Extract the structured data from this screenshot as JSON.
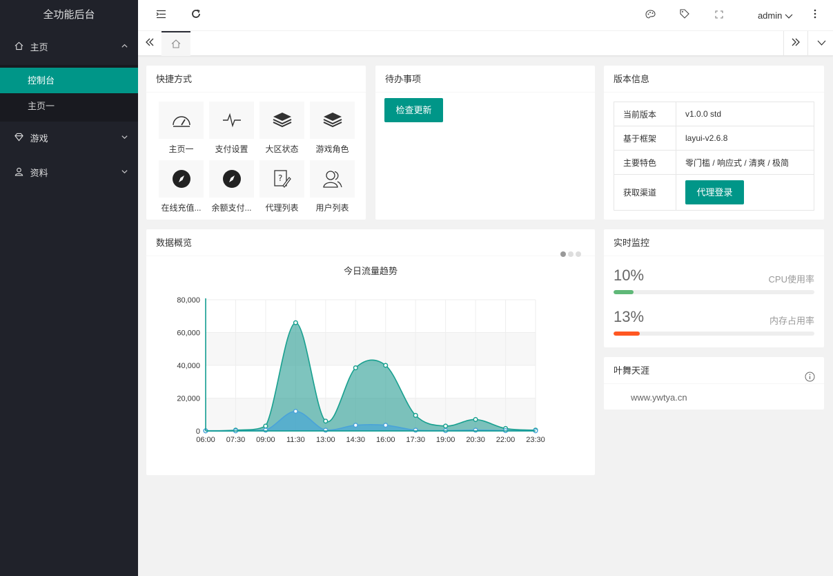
{
  "app": {
    "title": "全功能后台"
  },
  "sidebar": {
    "items": [
      {
        "label": "主页",
        "icon": "home-icon",
        "open": true,
        "children": [
          {
            "label": "控制台",
            "active": true
          },
          {
            "label": "主页一"
          }
        ]
      },
      {
        "label": "游戏",
        "icon": "diamond-icon"
      },
      {
        "label": "资料",
        "icon": "user-icon"
      }
    ]
  },
  "header": {
    "user": "admin"
  },
  "tabs": {
    "home_icon": "home-icon"
  },
  "shortcuts": {
    "title": "快捷方式",
    "items": [
      {
        "label": "主页一",
        "icon": "dashboard-icon"
      },
      {
        "label": "支付设置",
        "icon": "pulse-icon"
      },
      {
        "label": "大区状态",
        "icon": "layers-icon"
      },
      {
        "label": "游戏角色",
        "icon": "layers-icon"
      },
      {
        "label": "在线充值...",
        "icon": "compass-icon"
      },
      {
        "label": "余额支付...",
        "icon": "compass-icon"
      },
      {
        "label": "代理列表",
        "icon": "edit-doc-icon"
      },
      {
        "label": "用户列表",
        "icon": "users-icon"
      }
    ]
  },
  "todo": {
    "title": "待办事项",
    "button": "检查更新"
  },
  "version": {
    "title": "版本信息",
    "rows": [
      {
        "key": "当前版本",
        "value": "v1.0.0 std"
      },
      {
        "key": "基于框架",
        "value": "layui-v2.6.8"
      },
      {
        "key": "主要特色",
        "value": "零门槛 / 响应式 / 清爽 / 极简"
      },
      {
        "key": "获取渠道",
        "button": "代理登录"
      }
    ]
  },
  "overview": {
    "title": "数据概览",
    "chart_title": "今日流量趋势"
  },
  "monitor": {
    "title": "实时监控",
    "items": [
      {
        "value": "10%",
        "label": "CPU使用率",
        "percent": 10,
        "color": "#5FB878"
      },
      {
        "value": "13%",
        "label": "内存占用率",
        "percent": 13,
        "color": "#FF5722"
      }
    ]
  },
  "about": {
    "title": "叶舞天涯",
    "url": "www.ywtya.cn"
  },
  "colors": {
    "accent": "#009688",
    "sidebar": "#20222a",
    "series1": "#2ec7c9",
    "series2": "#5ab1ef"
  },
  "chart_data": {
    "type": "area",
    "title": "今日流量趋势",
    "x_ticks": [
      "06:00",
      "07:30",
      "09:00",
      "11:30",
      "13:00",
      "14:30",
      "16:00",
      "17:30",
      "19:00",
      "20:30",
      "22:00",
      "23:30"
    ],
    "y_ticks": [
      "0",
      "20,000",
      "40,000",
      "60,000",
      "80,000"
    ],
    "ylim": [
      0,
      80000
    ],
    "series": [
      {
        "values": [
          100,
          500,
          3000,
          66000,
          6000,
          38500,
          40000,
          9500,
          3000,
          7000,
          1500,
          500
        ]
      },
      {
        "values": [
          50,
          80,
          500,
          12000,
          500,
          3500,
          3500,
          500,
          200,
          500,
          200,
          100
        ]
      }
    ]
  }
}
